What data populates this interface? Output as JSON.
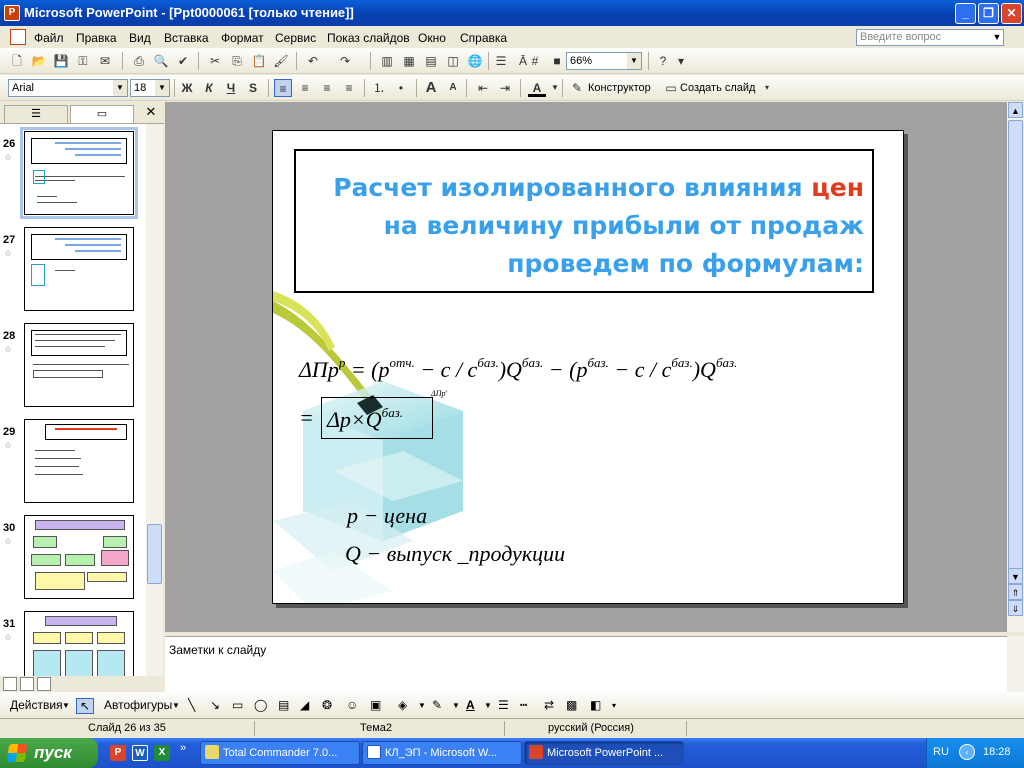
{
  "window": {
    "title": "Microsoft PowerPoint - [Ppt0000061 [только чтение]]",
    "app_icon_letter": "P"
  },
  "menu": {
    "items": [
      "Файл",
      "Правка",
      "Вид",
      "Вставка",
      "Формат",
      "Сервис",
      "Показ слайдов",
      "Окно",
      "Справка"
    ],
    "help_placeholder": "Введите вопрос"
  },
  "toolbar": {
    "zoom": "66%",
    "font": "Arial",
    "font_size": "18",
    "bold_label": "Ж",
    "italic_label": "К",
    "underline_label": "Ч",
    "shadow_label": "S",
    "designer_label": "Конструктор",
    "new_slide_label": "Создать слайд"
  },
  "outline": {
    "thumbnails": [
      {
        "number": "26",
        "selected": true
      },
      {
        "number": "27",
        "selected": false
      },
      {
        "number": "28",
        "selected": false
      },
      {
        "number": "29",
        "selected": false
      },
      {
        "number": "30",
        "selected": false
      },
      {
        "number": "31",
        "selected": false
      }
    ]
  },
  "slide": {
    "title_part1": "Расчет изолированного влияния ",
    "title_highlight": "цен",
    "title_part2": " на величину прибыли от продаж проведем по формулам:",
    "formula_main": "ΔП",
    "formula_sup_p": "p",
    "formula_eq1": " = (",
    "formula_p": "p",
    "formula_sup_otch": "отч.",
    "formula_c1": " − c / c",
    "formula_sup_baz1": "баз.",
    "formula_q1": ")Q",
    "formula_sup_baz2": "баз.",
    "formula_minus": " − (",
    "formula_p2": "p",
    "formula_sup_baz3": "баз.",
    "formula_c2": " − c / c",
    "formula_sup_baz4": "баз.",
    "formula_q2": ")Q",
    "formula_sup_baz5": "баз.",
    "formula_line2_eq": "=",
    "formula_line2_body": "Δp×Q",
    "formula_line2_sup": "баз.",
    "formula_tiny": "ΔПр'",
    "legend_p": "p − цена",
    "legend_q": "Q − выпуск _продукции"
  },
  "notes": {
    "placeholder": "Заметки к слайду"
  },
  "drawbar": {
    "actions_label": "Действия",
    "autoshapes_label": "Автофигуры"
  },
  "status": {
    "slide_counter": "Слайд 26 из 35",
    "theme": "Тема2",
    "language": "русский (Россия)"
  },
  "taskbar": {
    "start_label": "пуск",
    "tasks": [
      "Total Commander 7.0...",
      "КЛ_ЭП - Microsoft W...",
      "Microsoft PowerPoint ..."
    ],
    "lang": "RU",
    "time": "18:28"
  },
  "colors": {
    "title_blue": "#3ba0ec",
    "title_red": "#e13a1d",
    "xp_blue": "#245edb"
  }
}
